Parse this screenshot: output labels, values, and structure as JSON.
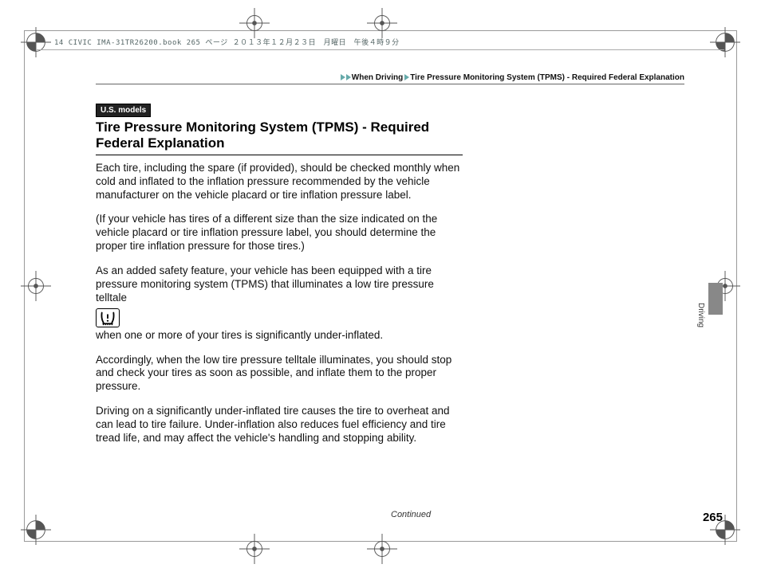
{
  "meta": {
    "header": "14 CIVIC IMA-31TR26200.book  265 ページ  ２０１３年１２月２３日　月曜日　午後４時９分"
  },
  "breadcrumb": {
    "part1": "When Driving",
    "part2": "Tire Pressure Monitoring System (TPMS) - Required Federal Explanation"
  },
  "badge": "U.S. models",
  "title": "Tire Pressure Monitoring System (TPMS) - Required Federal Explanation",
  "paragraphs": {
    "p1": "Each tire, including the spare (if provided), should be checked monthly when cold and inflated to the inflation pressure recommended by the vehicle manufacturer on the vehicle placard or tire inflation pressure label.",
    "p2": "(If your vehicle has tires of a different size than the size indicated on the vehicle placard or tire inflation pressure label, you should determine the proper tire inflation pressure for those tires.)",
    "p3": "As an added safety feature, your vehicle has been equipped with a tire pressure monitoring system (TPMS) that illuminates a low tire pressure telltale",
    "p4": "when one or more of your tires is significantly under-inflated.",
    "p5": "Accordingly, when the low tire pressure telltale illuminates, you should stop and check your tires as soon as possible, and inflate them to the proper pressure.",
    "p6": "Driving on a significantly under-inflated tire causes the tire to overheat and can lead to tire failure. Under-inflation also reduces fuel efficiency and tire tread life, and may affect the vehicle's handling and stopping ability."
  },
  "continued": "Continued",
  "page_number": "265",
  "side_label": "Driving"
}
